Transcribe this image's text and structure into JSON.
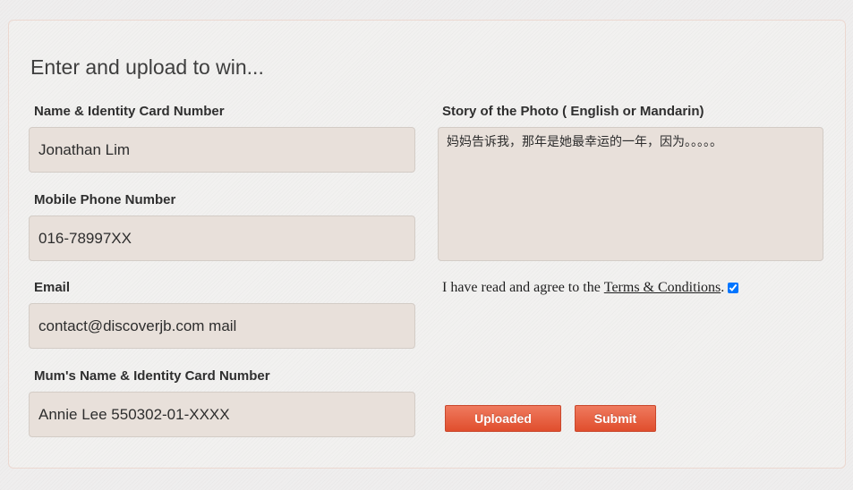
{
  "form": {
    "title": "Enter and upload to win...",
    "name": {
      "label": "Name & Identity Card Number",
      "value": "Jonathan Lim"
    },
    "mobile": {
      "label": "Mobile Phone Number",
      "value": "016-78997XX"
    },
    "email": {
      "label": "Email",
      "value": "contact@discoverjb.com mail"
    },
    "mum": {
      "label": "Mum's Name & Identity Card Number",
      "value": "Annie Lee 550302-01-XXXX"
    },
    "story": {
      "label": "Story of the Photo ( English or Mandarin)",
      "value": "妈妈告诉我，那年是她最幸运的一年，因为。。。。。"
    },
    "terms": {
      "prefix": "I have read and agree to the",
      "link": "Terms & Conditions",
      "suffix": ".",
      "checked": true
    },
    "buttons": {
      "upload": "Uploaded",
      "submit": "Submit"
    },
    "colors": {
      "field_bg": "#e8e0da",
      "button_top": "#ef7a5e",
      "button_bottom": "#e04e2d"
    }
  }
}
